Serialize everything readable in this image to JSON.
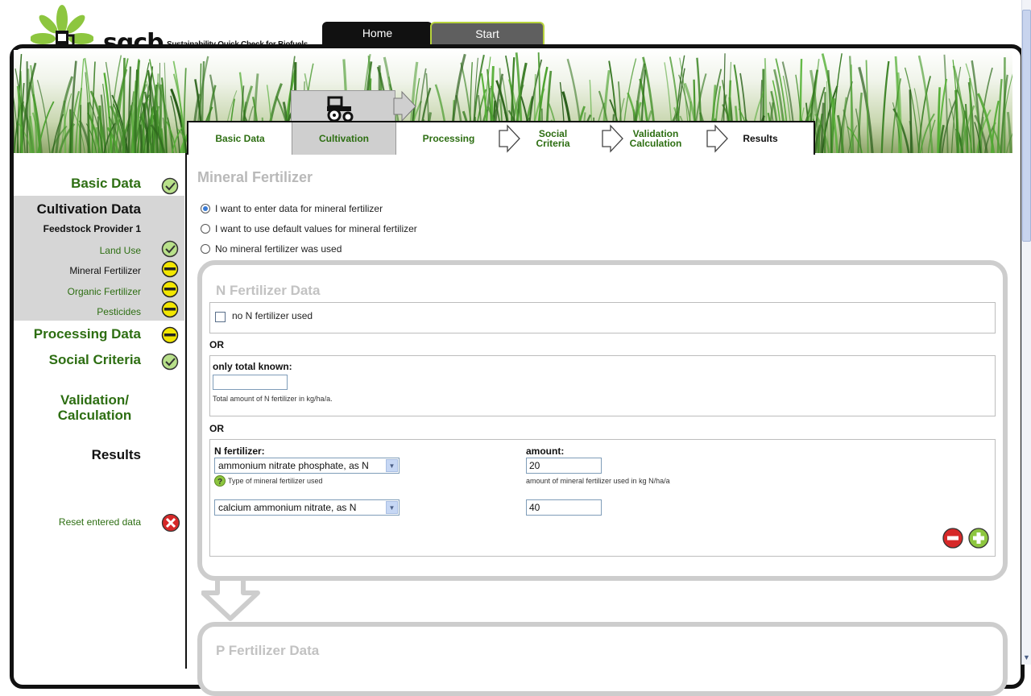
{
  "header": {
    "brand": "sqcb",
    "tagline": "Sustainability Quick Check for Biofuels",
    "tabs": [
      {
        "label": "Home"
      },
      {
        "label": "Start"
      }
    ]
  },
  "wizard": {
    "steps": [
      {
        "label": "Basic Data"
      },
      {
        "label": "Cultivation"
      },
      {
        "label": "Processing"
      },
      {
        "label": "Social Criteria"
      },
      {
        "label": "Validation Calculation"
      },
      {
        "label": "Results"
      }
    ],
    "social_line1": "Social",
    "social_line2": "Criteria",
    "valid_line1": "Validation",
    "valid_line2": "Calculation"
  },
  "sidebar": {
    "basic_data": "Basic Data",
    "cultivation_data": "Cultivation Data",
    "feedstock_provider": "Feedstock Provider 1",
    "land_use": "Land Use",
    "mineral_fertilizer": "Mineral Fertilizer",
    "organic_fertilizer": "Organic Fertilizer",
    "pesticides": "Pesticides",
    "processing_data": "Processing Data",
    "social_criteria": "Social Criteria",
    "validation_line1": "Validation/",
    "validation_line2": "Calculation",
    "results": "Results",
    "reset": "Reset entered data"
  },
  "main": {
    "title": "Mineral Fertilizer",
    "options": [
      {
        "label": "I want to enter data for mineral fertilizer",
        "selected": true
      },
      {
        "label": "I want to use default values for mineral fertilizer",
        "selected": false
      },
      {
        "label": "No mineral fertilizer was used",
        "selected": false
      }
    ],
    "n_panel": {
      "title": "N Fertilizer Data",
      "no_n_label": "no N fertilizer used",
      "or1": "OR",
      "only_total_label": "only total known:",
      "only_total_value": "",
      "only_total_hint": "Total amount of N fertilizer in kg/ha/a.",
      "or2": "OR",
      "n_fertilizer_label": "N fertilizer:",
      "amount_label": "amount:",
      "type_hint": "Type of mineral fertilizer used",
      "amount_hint": "amount of mineral fertilizer used in kg N/ha/a",
      "rows": [
        {
          "fertilizer": "ammonium nitrate phosphate, as N",
          "amount": "20"
        },
        {
          "fertilizer": "calcium ammonium nitrate, as N",
          "amount": "40"
        }
      ]
    },
    "p_panel": {
      "title": "P Fertilizer Data"
    }
  },
  "colors": {
    "accent_green": "#2d6e12",
    "status_yellow": "#f2e600",
    "status_ok": "#7cc13a",
    "brand_green": "#8dc63f"
  }
}
